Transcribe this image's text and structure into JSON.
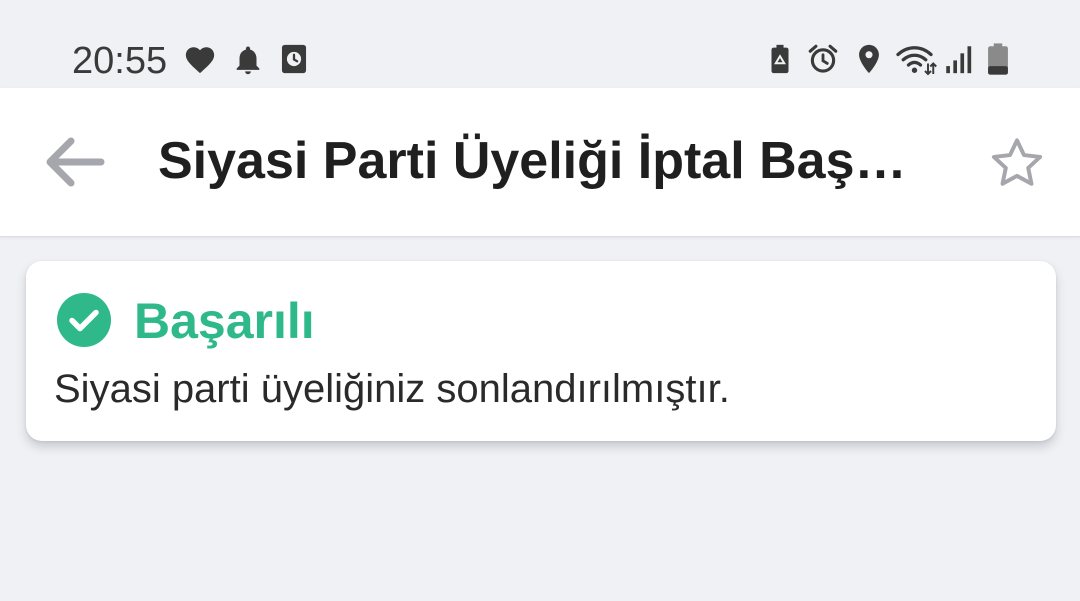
{
  "status_bar": {
    "time": "20:55",
    "left_icons": [
      "heart-icon",
      "bell-icon",
      "clock-app-icon"
    ],
    "right_icons": [
      "battery-saver-icon",
      "alarm-icon",
      "location-icon",
      "wifi-icon",
      "signal-icon",
      "battery-icon"
    ]
  },
  "app_bar": {
    "title": "Siyasi Parti Üyeliği İptal Başvurusu",
    "back_icon": "arrow-left-icon",
    "favorite_icon": "star-outline-icon"
  },
  "result_card": {
    "status_icon": "check-circle-icon",
    "title": "Başarılı",
    "message": "Siyasi parti üyeliğiniz sonlandırılmıştır."
  },
  "colors": {
    "background": "#f0f1f4",
    "surface": "#ffffff",
    "success": "#2fb98a",
    "title_text": "#1f1f1f",
    "icon_muted": "#a6a6ad"
  }
}
